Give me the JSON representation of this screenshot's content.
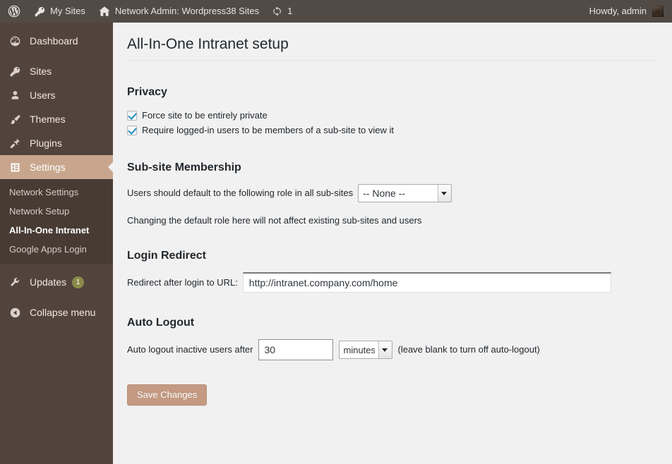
{
  "adminbar": {
    "wp_logo_icon": "wordpress-logo-icon",
    "items": [
      {
        "icon": "key-icon",
        "label": "My Sites"
      },
      {
        "icon": "home-icon",
        "label": "Network Admin: Wordpress38 Sites"
      },
      {
        "icon": "update-icon",
        "label": "1"
      }
    ],
    "howdy": "Howdy, admin",
    "avatar_name": "user-avatar"
  },
  "sidebar": {
    "items": [
      {
        "label": "Dashboard",
        "icon": "dashboard-icon",
        "current": false
      },
      {
        "label": "Sites",
        "icon": "key-icon",
        "current": false
      },
      {
        "label": "Users",
        "icon": "users-icon",
        "current": false
      },
      {
        "label": "Themes",
        "icon": "themes-icon",
        "current": false
      },
      {
        "label": "Plugins",
        "icon": "plugins-icon",
        "current": false
      },
      {
        "label": "Settings",
        "icon": "settings-icon",
        "current": true
      }
    ],
    "submenu": [
      {
        "label": "Network Settings",
        "current": false
      },
      {
        "label": "Network Setup",
        "current": false
      },
      {
        "label": "All-In-One Intranet",
        "current": true
      },
      {
        "label": "Google Apps Login",
        "current": false
      }
    ],
    "updates": {
      "label": "Updates",
      "icon": "wrench-icon",
      "count": "1"
    },
    "collapse": {
      "label": "Collapse menu",
      "icon": "collapse-arrow-icon"
    },
    "highlight_color": "#c7a68d",
    "background_color": "#52443c"
  },
  "main": {
    "page_title": "All-In-One Intranet setup",
    "privacy": {
      "heading": "Privacy",
      "checkbox_force_private": {
        "label": "Force site to be entirely private",
        "checked": true
      },
      "checkbox_require_member": {
        "label": "Require logged-in users to be members of a sub-site to view it",
        "checked": true
      }
    },
    "membership": {
      "heading": "Sub-site Membership",
      "role_label": "Users should default to the following role in all sub-sites",
      "role_value": "-- None --",
      "role_options": [
        "-- None --"
      ],
      "note": "Changing the default role here will not affect existing sub-sites and users"
    },
    "login_redirect": {
      "heading": "Login Redirect",
      "url_label": "Redirect after login to URL:",
      "url_value": "http://intranet.company.com/home",
      "url_placeholder": ""
    },
    "auto_logout": {
      "heading": "Auto Logout",
      "label": "Auto logout inactive users after",
      "minutes_value": "30",
      "minutes_placeholder": "",
      "units_value": "minutes",
      "units_options": [
        "minutes"
      ],
      "note": "(leave blank to turn off auto-logout)"
    },
    "save_button": "Save Changes",
    "save_button_color": "#c49a82"
  }
}
